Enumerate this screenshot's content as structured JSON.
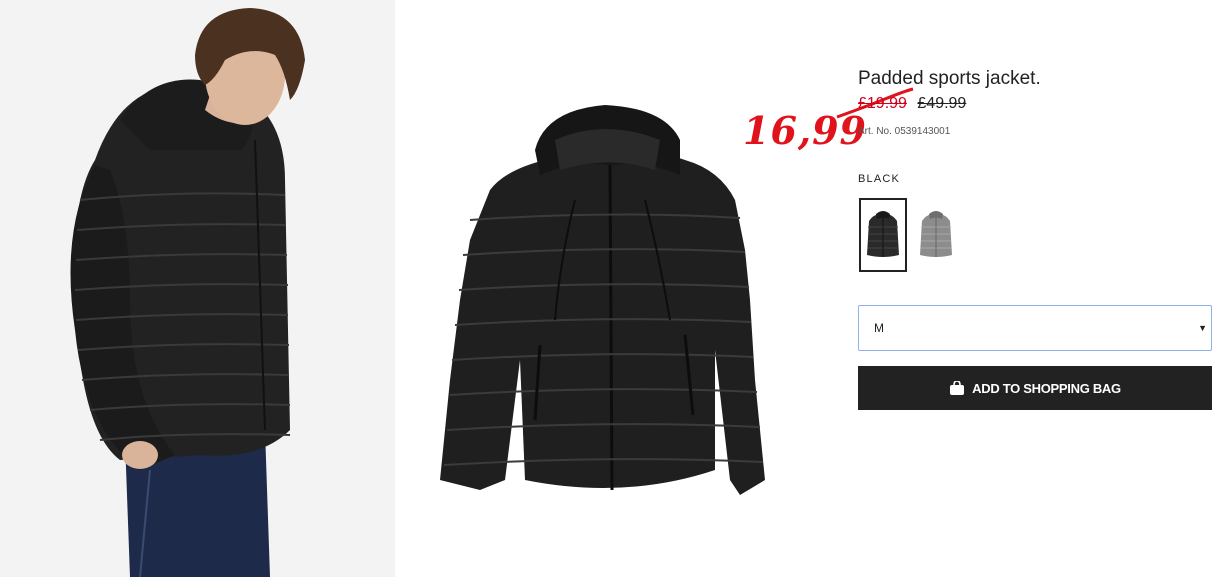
{
  "product": {
    "title": "Padded sports jacket.",
    "sale_price": "£19.99",
    "original_price": "£49.99",
    "article_number": "Art. No. 0539143001"
  },
  "annotation": {
    "handwritten_price": "16,99",
    "color": "#e0121b"
  },
  "colors": {
    "selected_label": "BLACK",
    "swatches": [
      {
        "name": "black",
        "selected": true
      },
      {
        "name": "grey",
        "selected": false
      }
    ]
  },
  "size_select": {
    "value": "M"
  },
  "actions": {
    "add_to_bag_label": "ADD TO SHOPPING BAG"
  },
  "theme": {
    "accent_red": "#d0021b",
    "button_bg": "#222222",
    "focus_border": "#8fb0e8"
  }
}
